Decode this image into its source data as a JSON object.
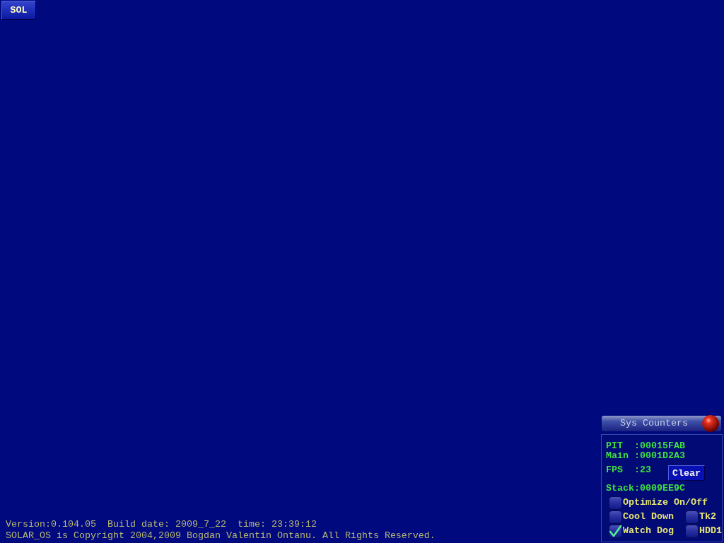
{
  "start_button": {
    "label": "SOL"
  },
  "footer": {
    "lines": [
      "Version:0.104.05  Build date: 2009_7_22  time: 23:39:12",
      "SOLAR_OS is Copyright 2004,2009 Bogdan Valentin Ontanu. All Rights Reserved."
    ]
  },
  "sys_counters": {
    "title": "Sys Counters",
    "counters": [
      "PIT  :00015FAB",
      "Main :0001D2A3"
    ],
    "fps": "FPS  :23",
    "clear_button": "Clear",
    "stack": "Stack:0009EE9C",
    "option_rows": [
      [
        {
          "label": "Optimize On/Off",
          "checked": false
        }
      ],
      [
        {
          "label": "Cool Down",
          "checked": false
        },
        {
          "label": "Tk2",
          "checked": false
        }
      ],
      [
        {
          "label": "Watch Dog",
          "checked": true
        },
        {
          "label": "HDD1",
          "checked": false
        }
      ]
    ]
  }
}
